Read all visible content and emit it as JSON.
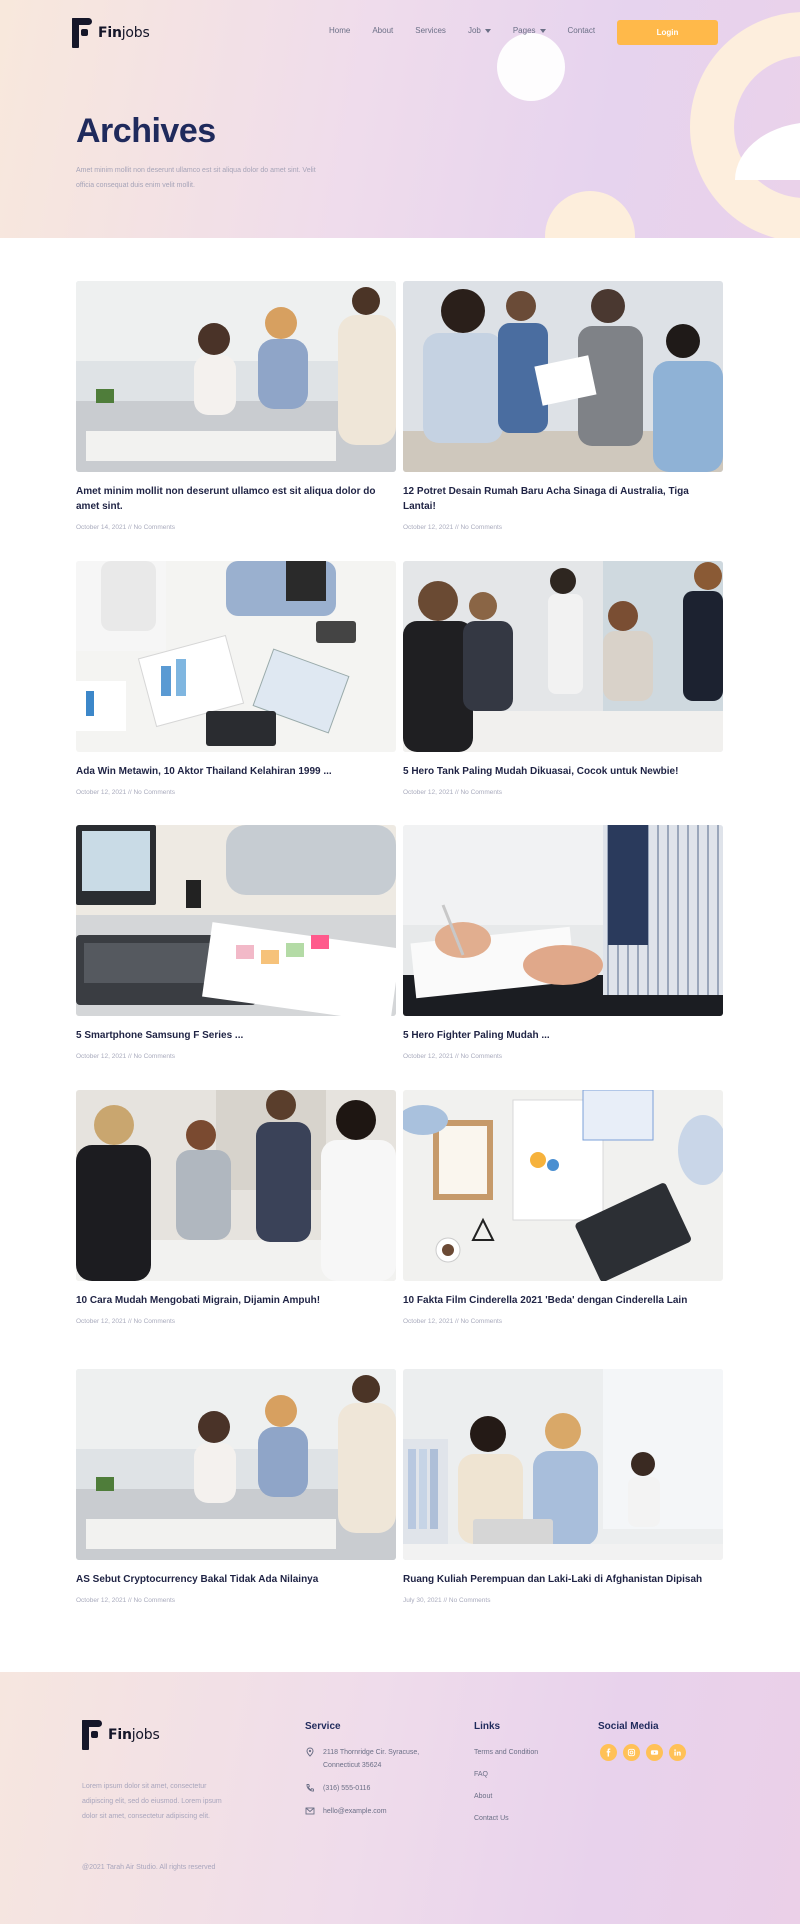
{
  "brand": {
    "name_bold": "Fin",
    "name_light": "jobs"
  },
  "nav": {
    "items": [
      {
        "label": "Home"
      },
      {
        "label": "About"
      },
      {
        "label": "Services"
      },
      {
        "label": "Job"
      },
      {
        "label": "Pages"
      },
      {
        "label": "Contact"
      }
    ],
    "login_label": "Login"
  },
  "hero": {
    "title": "Archives",
    "subtitle": "Amet minim mollit non deserunt ullamco est sit aliqua dolor do amet sint. Velit officia consequat duis enim velit mollit."
  },
  "posts": [
    {
      "title": "Amet minim mollit non deserunt ullamco est sit aliqua dolor do amet sint.",
      "date": "October 14, 2021",
      "comments": "No Comments"
    },
    {
      "title": "12 Potret Desain Rumah Baru Acha Sinaga di Australia, Tiga Lantai!",
      "date": "October 12, 2021",
      "comments": "No Comments"
    },
    {
      "title": "Ada Win Metawin, 10 Aktor Thailand Kelahiran 1999 ...",
      "date": "October 12, 2021",
      "comments": "No Comments"
    },
    {
      "title": "5 Hero Tank Paling Mudah Dikuasai, Cocok untuk Newbie!",
      "date": "October 12, 2021",
      "comments": "No Comments"
    },
    {
      "title": "5 Smartphone Samsung F Series ...",
      "date": "October 12, 2021",
      "comments": "No Comments"
    },
    {
      "title": "5 Hero Fighter Paling Mudah ...",
      "date": "October 12, 2021",
      "comments": "No Comments"
    },
    {
      "title": "10 Cara Mudah Mengobati Migrain, Dijamin Ampuh!",
      "date": "October 12, 2021",
      "comments": "No Comments"
    },
    {
      "title": "10 Fakta Film Cinderella 2021 'Beda' dengan Cinderella Lain",
      "date": "October 12, 2021",
      "comments": "No Comments"
    },
    {
      "title": "AS Sebut Cryptocurrency Bakal Tidak Ada Nilainya",
      "date": "October 12, 2021",
      "comments": "No Comments"
    },
    {
      "title": "Ruang Kuliah Perempuan dan Laki-Laki di Afghanistan Dipisah",
      "date": "July 30, 2021",
      "comments": "No Comments"
    }
  ],
  "meta_separator": "//",
  "footer": {
    "description": "Lorem ipsum dolor sit amet, consectetur adipiscing elit, sed do eiusmod. Lorem ipsum dolor sit amet, consectetur adipiscing elit.",
    "copyright": "@2021 Tarah Air Studio. All rights reserved",
    "service": {
      "heading": "Service",
      "address_line1": "2118 Thornridge Cir. Syracuse,",
      "address_line2": "Connecticut 35624",
      "phone": "(316) 555-0116",
      "email": "hello@example.com"
    },
    "links": {
      "heading": "Links",
      "items": [
        {
          "label": "Terms and Condition"
        },
        {
          "label": "FAQ"
        },
        {
          "label": "About"
        },
        {
          "label": "Contact Us"
        }
      ]
    },
    "social": {
      "heading": "Social Media",
      "icons": [
        "facebook-icon",
        "instagram-icon",
        "youtube-icon",
        "linkedin-icon"
      ]
    }
  },
  "colors": {
    "accent": "#ffb94a",
    "heading": "#1f2a5c",
    "text_muted": "#a9abbd"
  }
}
